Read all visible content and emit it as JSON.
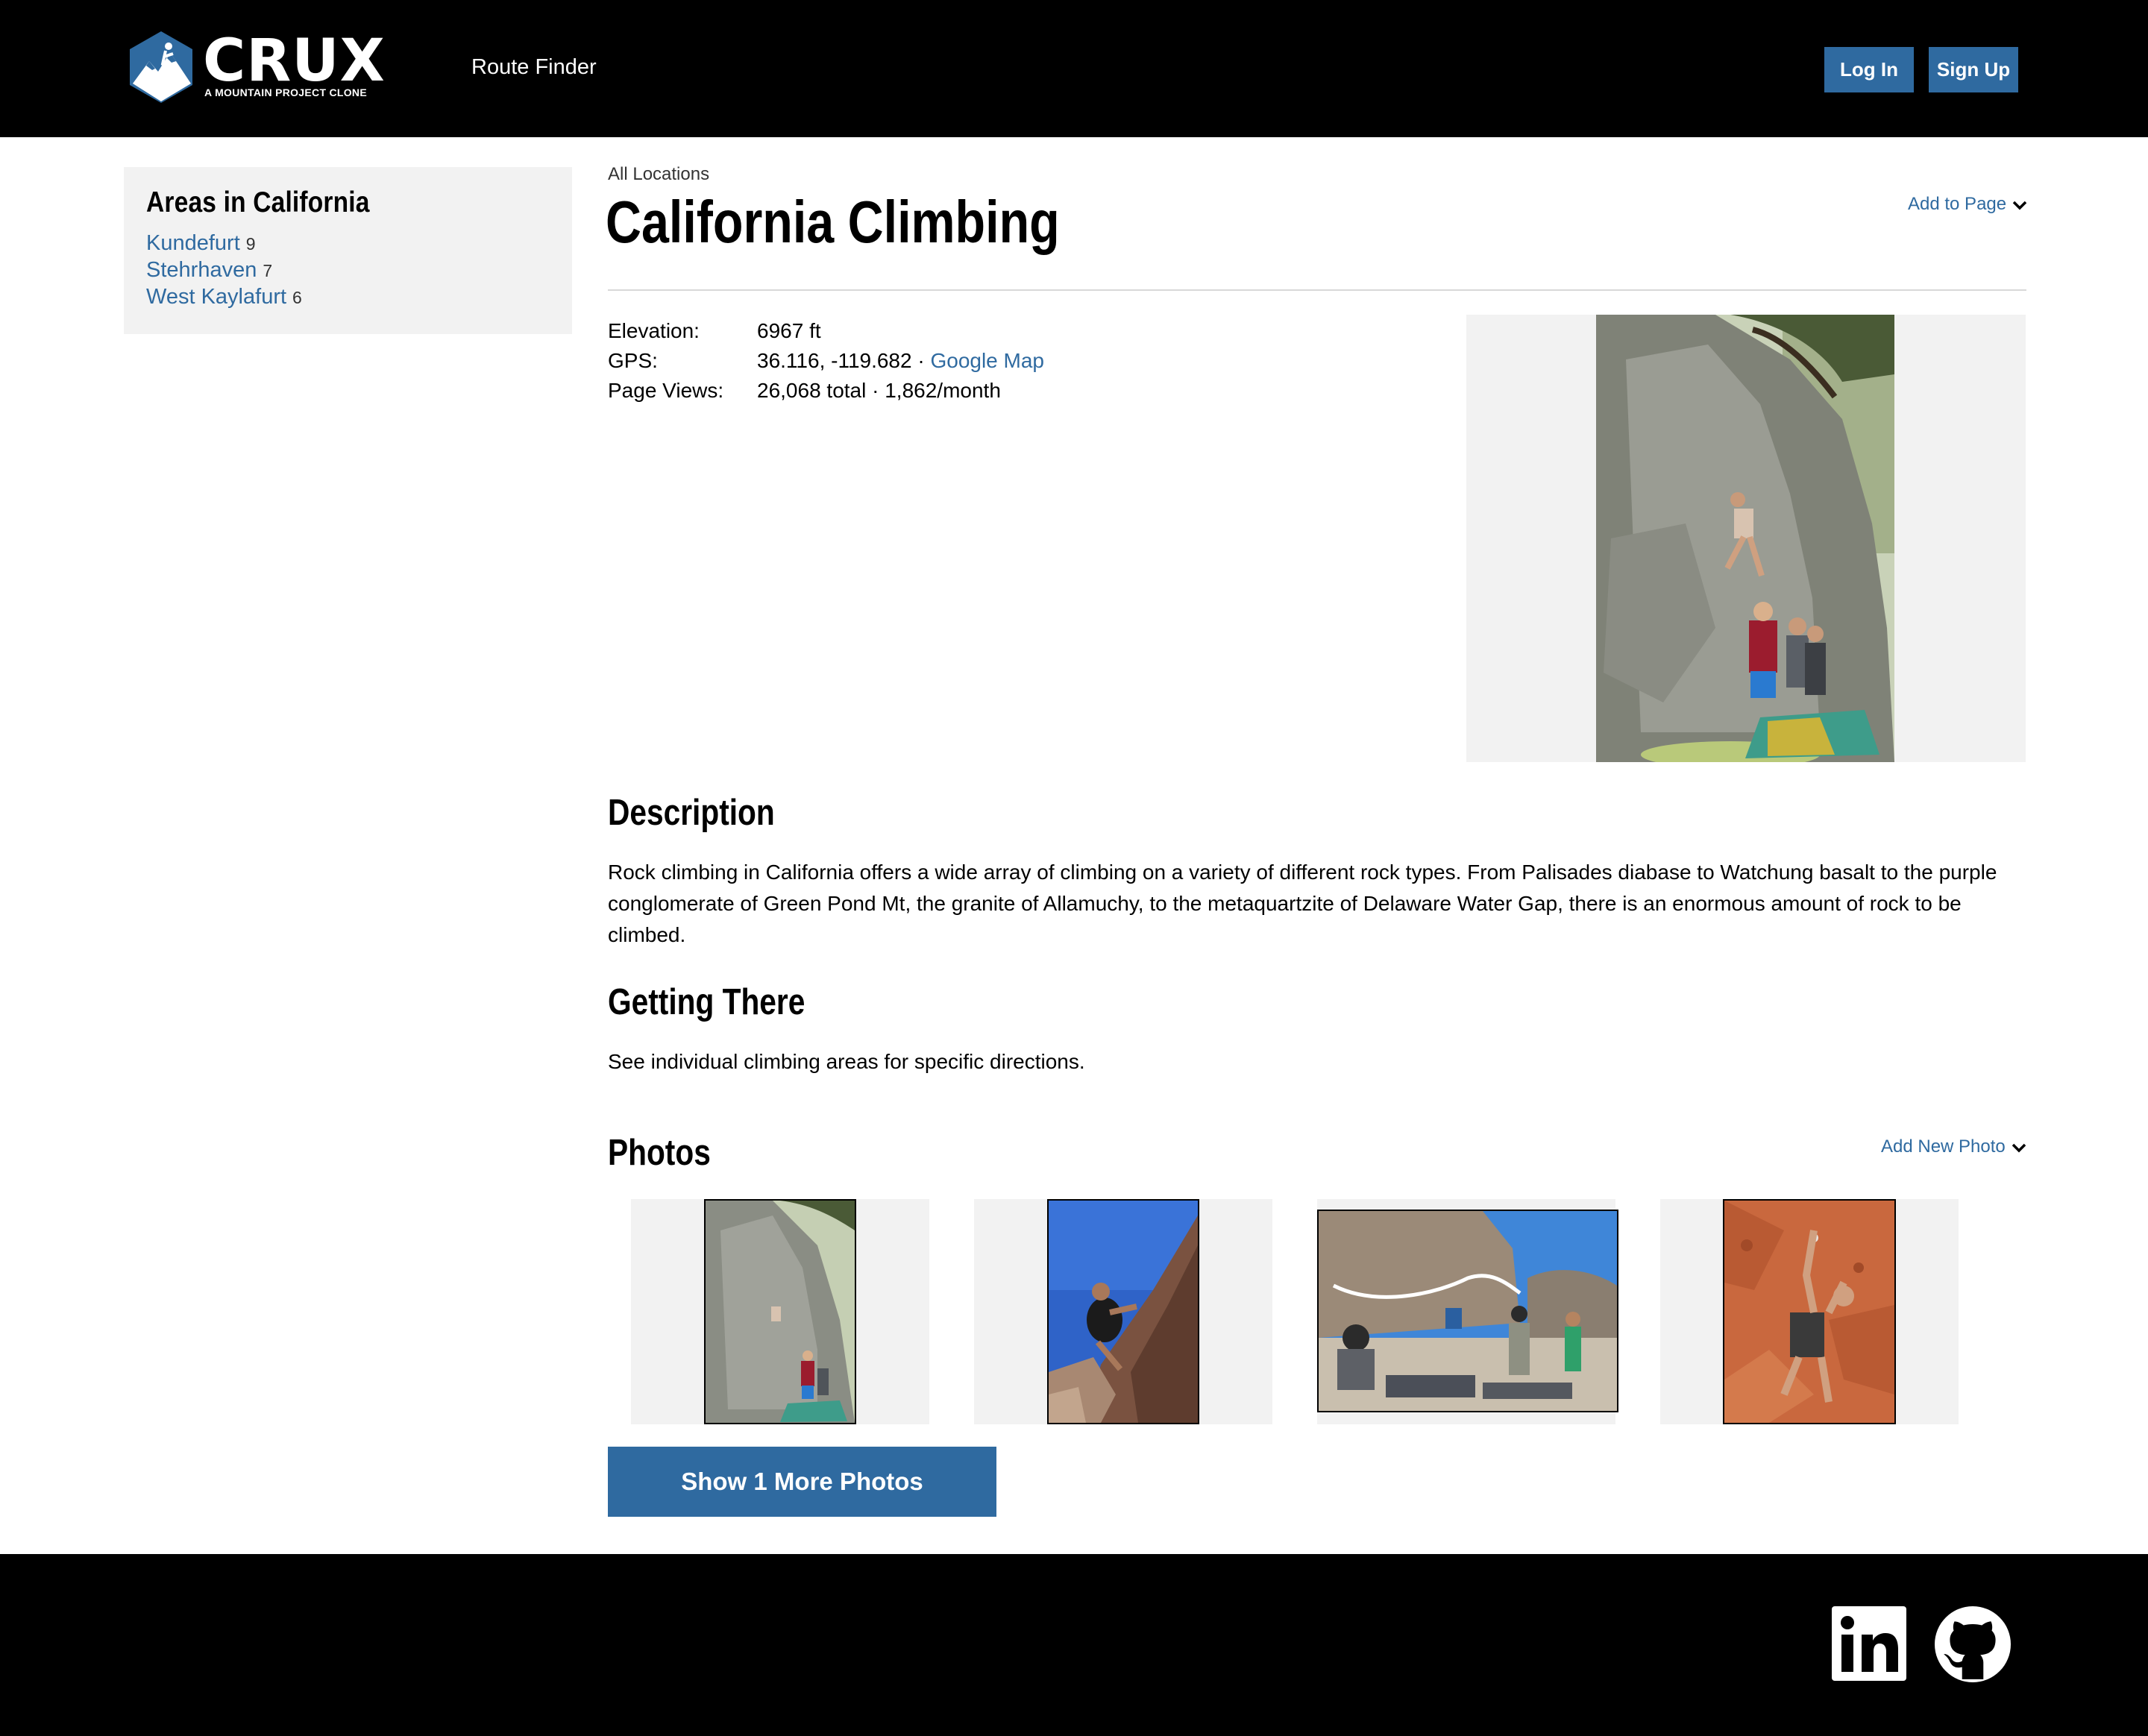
{
  "header": {
    "logo_word": "CRUX",
    "logo_tagline": "A MOUNTAIN PROJECT CLONE",
    "nav_route_finder": "Route Finder",
    "login_label": "Log In",
    "signup_label": "Sign Up"
  },
  "sidebar": {
    "title": "Areas in California",
    "areas": [
      {
        "name": "Kundefurt",
        "count": "9"
      },
      {
        "name": "Stehrhaven",
        "count": "7"
      },
      {
        "name": "West Kaylafurt",
        "count": "6"
      }
    ]
  },
  "main": {
    "breadcrumb": "All Locations",
    "title": "California Climbing",
    "add_to_page": "Add to Page",
    "info": {
      "elevation_label": "Elevation:",
      "elevation_value": "6967 ft",
      "gps_label": "GPS:",
      "gps_value": "36.116, -119.682 · ",
      "gps_link": "Google Map",
      "views_label": "Page Views:",
      "views_value": "26,068 total · 1,862/month"
    },
    "description_heading": "Description",
    "description_text": "Rock climbing in California offers a wide array of climbing on a variety of different rock types. From Palisades diabase to Watchung basalt to the purple conglomerate of Green Pond Mt, the granite of Allamuchy, to the metaquartzite of Delaware Water Gap, there is an enormous amount of rock to be climbed.",
    "getting_there_heading": "Getting There",
    "getting_there_text": "See individual climbing areas for specific directions.",
    "photos_heading": "Photos",
    "add_new_photo": "Add New Photo",
    "show_more_label": "Show 1 More Photos"
  },
  "colors": {
    "accent": "#2f6aa0",
    "header_bg": "#000000",
    "panel_bg": "#f2f2f2"
  },
  "footer": {
    "icons": [
      "linkedin-icon",
      "github-icon"
    ]
  }
}
